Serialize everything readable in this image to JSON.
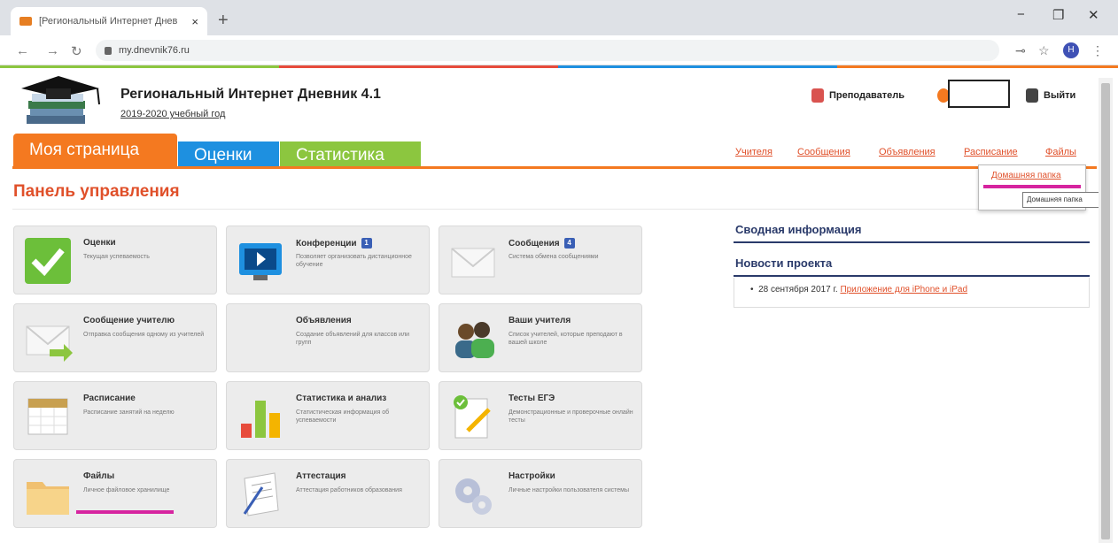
{
  "browser": {
    "tab_title": "[Региональный Интернет Днев",
    "tab_close": "×",
    "new_tab": "+",
    "url": "my.dnevnik76.ru",
    "win_min": "−",
    "win_max": "❐",
    "win_close": "✕",
    "profile_letter": "Н"
  },
  "site": {
    "title": "Региональный Интернет Дневник 4.1",
    "subtitle": "2019-2020 учебный год",
    "role_link": "Преподаватель",
    "logout_link": "Выйти"
  },
  "main_tabs": [
    "Моя страница",
    "Оценки",
    "Статистика"
  ],
  "sub_nav": [
    "Учителя",
    "Сообщения",
    "Объявления",
    "Расписание",
    "Файлы"
  ],
  "dropdown": {
    "item": "Домашняя папка",
    "tooltip": "Домашняя папка"
  },
  "panel_title": "Панель управления",
  "tiles": [
    {
      "title": "Оценки",
      "desc": "Текущая успеваемость",
      "badge": ""
    },
    {
      "title": "Конференции",
      "desc": "Позволяет организовать дистанционное обучение",
      "badge": "1"
    },
    {
      "title": "Сообщения",
      "desc": "Система обмена сообщениями",
      "badge": "4"
    },
    {
      "title": "Сообщение учителю",
      "desc": "Отправка сообщения одному из учителей",
      "badge": ""
    },
    {
      "title": "Объявления",
      "desc": "Создание объявлений для классов или групп",
      "badge": ""
    },
    {
      "title": "Ваши учителя",
      "desc": "Список учителей, которые преподают в вашей школе",
      "badge": ""
    },
    {
      "title": "Расписание",
      "desc": "Расписание занятий на неделю",
      "badge": ""
    },
    {
      "title": "Статистика и анализ",
      "desc": "Статистическая информация об успеваемости",
      "badge": ""
    },
    {
      "title": "Тесты ЕГЭ",
      "desc": "Демонстрационные и проверочные онлайн тесты",
      "badge": ""
    },
    {
      "title": "Файлы",
      "desc": "Личное файловое хранилище",
      "badge": ""
    },
    {
      "title": "Аттестация",
      "desc": "Аттестация работников образования",
      "badge": ""
    },
    {
      "title": "Настройки",
      "desc": "Личные настройки пользователя системы",
      "badge": ""
    }
  ],
  "right": {
    "summary_title": "Сводная информация",
    "news_title": "Новости проекта",
    "news_date": "28 сентября 2017 г.",
    "news_link": "Приложение для iPhone и iPad"
  },
  "colors": {
    "accent_orange": "#f47920",
    "link": "#e0502a",
    "tab_orange": "#f47920",
    "tab_blue": "#1e90e0",
    "tab_green": "#8cc63f",
    "highlight": "#d6249f",
    "heading_blue": "#2a3a6a"
  }
}
